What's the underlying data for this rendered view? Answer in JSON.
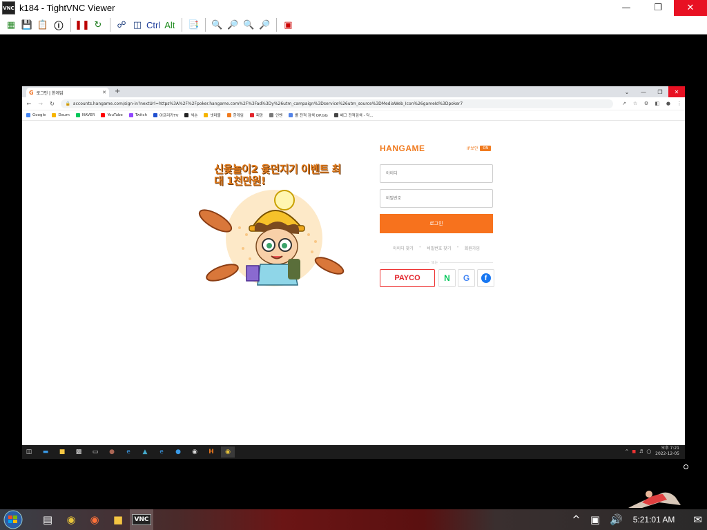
{
  "window": {
    "title": "k184 - TightVNC Viewer",
    "app_icon": "VNC",
    "controls": [
      "minimize-icon",
      "maximize-icon",
      "close-icon"
    ]
  },
  "toolbar": {
    "ctrl_label": "Ctrl",
    "alt_label": "Alt"
  },
  "browser": {
    "tab_title": "로그인 | 한게임",
    "tab_favicon": "G",
    "url": "accounts.hangame.com/sign-in?nextUrl=https%3A%2F%2Fpoker.hangame.com%2F%3Fad%3Dy%26utm_campaign%3Dservice%26utm_source%3DMediaWeb_Icon%26gameId%3Dpoker7",
    "bookmarks": [
      {
        "label": "Google",
        "color": "#4285f4"
      },
      {
        "label": "Daum",
        "color": "#f7b500"
      },
      {
        "label": "NAVER",
        "color": "#03c75a"
      },
      {
        "label": "YouTube",
        "color": "#ff0000"
      },
      {
        "label": "Twitch",
        "color": "#9146ff"
      },
      {
        "label": "아프리카TV",
        "color": "#2050d0"
      },
      {
        "label": "넥슨",
        "color": "#222222"
      },
      {
        "label": "넷마블",
        "color": "#f5b400"
      },
      {
        "label": "한게임",
        "color": "#f07a1e"
      },
      {
        "label": "피망",
        "color": "#e3262d"
      },
      {
        "label": "인벤",
        "color": "#777777"
      },
      {
        "label": "롤 전적 검색 OP.GG",
        "color": "#5383e8"
      },
      {
        "label": "배그 전적검색 - 닥...",
        "color": "#444444"
      }
    ]
  },
  "login": {
    "logo": "HANGAME",
    "ip_security_label": "IP보안",
    "ip_security_state": "ON",
    "id_placeholder": "아이디",
    "password_placeholder": "비밀번호",
    "login_button": "로그인",
    "find_id": "아이디 찾기",
    "find_password": "비밀번호 찾기",
    "sign_up": "회원가입",
    "divider_text": "또는",
    "payco_label": "PAYCO",
    "naver_label": "N",
    "google_label": "G",
    "facebook_label": "f"
  },
  "promo": {
    "headline": "신윷놀이2 윷던지기 이벤트 최대 1천만원!"
  },
  "remote_taskbar": {
    "time": "오후 7:21",
    "date": "2022-12-05"
  },
  "host_taskbar": {
    "time": "5:21:01 AM"
  }
}
